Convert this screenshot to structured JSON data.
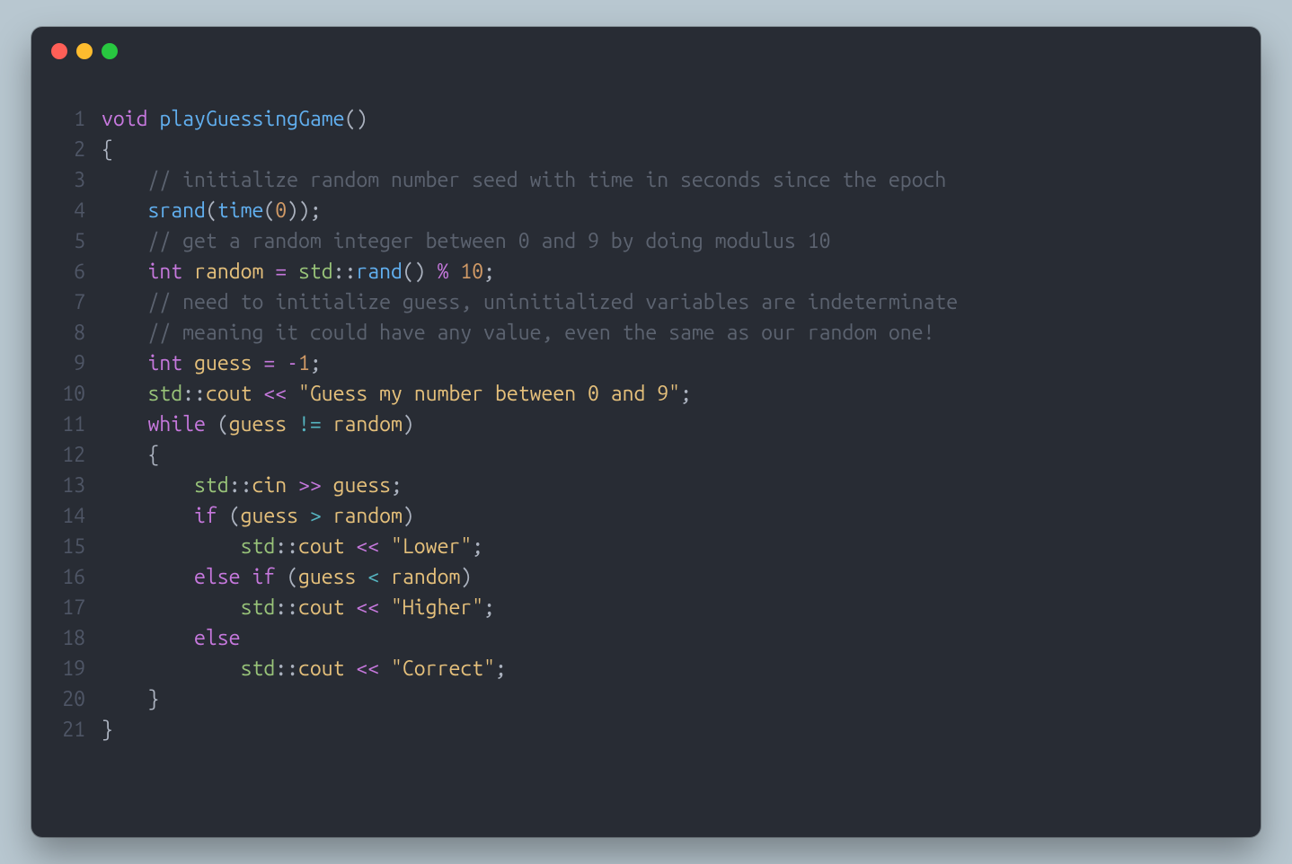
{
  "traffic_lights": [
    "close",
    "minimize",
    "zoom"
  ],
  "code": {
    "lines": [
      {
        "n": 1,
        "tokens": [
          [
            "kw",
            "void"
          ],
          [
            "punc",
            " "
          ],
          [
            "fn",
            "playGuessingGame"
          ],
          [
            "punc",
            "()"
          ]
        ]
      },
      {
        "n": 2,
        "tokens": [
          [
            "punc",
            "{"
          ]
        ]
      },
      {
        "n": 3,
        "tokens": [
          [
            "punc",
            "    "
          ],
          [
            "cmt",
            "// initialize random number seed with time in seconds since the epoch"
          ]
        ]
      },
      {
        "n": 4,
        "tokens": [
          [
            "punc",
            "    "
          ],
          [
            "fn",
            "srand"
          ],
          [
            "punc",
            "("
          ],
          [
            "fn",
            "time"
          ],
          [
            "punc",
            "("
          ],
          [
            "num",
            "0"
          ],
          [
            "punc",
            "));"
          ]
        ]
      },
      {
        "n": 5,
        "tokens": [
          [
            "punc",
            "    "
          ],
          [
            "cmt",
            "// get a random integer between 0 and 9 by doing modulus 10"
          ]
        ]
      },
      {
        "n": 6,
        "tokens": [
          [
            "punc",
            "    "
          ],
          [
            "type",
            "int"
          ],
          [
            "punc",
            " "
          ],
          [
            "var",
            "random"
          ],
          [
            "punc",
            " "
          ],
          [
            "opp",
            "="
          ],
          [
            "punc",
            " "
          ],
          [
            "ns",
            "std"
          ],
          [
            "punc",
            "::"
          ],
          [
            "fn",
            "rand"
          ],
          [
            "punc",
            "() "
          ],
          [
            "opp",
            "%"
          ],
          [
            "punc",
            " "
          ],
          [
            "num",
            "10"
          ],
          [
            "punc",
            ";"
          ]
        ]
      },
      {
        "n": 7,
        "tokens": [
          [
            "punc",
            "    "
          ],
          [
            "cmt",
            "// need to initialize guess, uninitialized variables are indeterminate"
          ]
        ]
      },
      {
        "n": 8,
        "tokens": [
          [
            "punc",
            "    "
          ],
          [
            "cmt",
            "// meaning it could have any value, even the same as our random one!"
          ]
        ]
      },
      {
        "n": 9,
        "tokens": [
          [
            "punc",
            "    "
          ],
          [
            "type",
            "int"
          ],
          [
            "punc",
            " "
          ],
          [
            "var",
            "guess"
          ],
          [
            "punc",
            " "
          ],
          [
            "opp",
            "="
          ],
          [
            "punc",
            " "
          ],
          [
            "opp",
            "-"
          ],
          [
            "num",
            "1"
          ],
          [
            "punc",
            ";"
          ]
        ]
      },
      {
        "n": 10,
        "tokens": [
          [
            "punc",
            "    "
          ],
          [
            "ns",
            "std"
          ],
          [
            "punc",
            "::"
          ],
          [
            "var",
            "cout"
          ],
          [
            "punc",
            " "
          ],
          [
            "opp",
            "<<"
          ],
          [
            "punc",
            " "
          ],
          [
            "str",
            "\"Guess my number between 0 and 9\""
          ],
          [
            "punc",
            ";"
          ]
        ]
      },
      {
        "n": 11,
        "tokens": [
          [
            "punc",
            "    "
          ],
          [
            "kw",
            "while"
          ],
          [
            "punc",
            " ("
          ],
          [
            "var",
            "guess"
          ],
          [
            "punc",
            " "
          ],
          [
            "op",
            "!="
          ],
          [
            "punc",
            " "
          ],
          [
            "var",
            "random"
          ],
          [
            "punc",
            ")"
          ]
        ]
      },
      {
        "n": 12,
        "tokens": [
          [
            "punc",
            "    {"
          ]
        ]
      },
      {
        "n": 13,
        "tokens": [
          [
            "punc",
            "        "
          ],
          [
            "ns",
            "std"
          ],
          [
            "punc",
            "::"
          ],
          [
            "var",
            "cin"
          ],
          [
            "punc",
            " "
          ],
          [
            "opp",
            ">>"
          ],
          [
            "punc",
            " "
          ],
          [
            "var",
            "guess"
          ],
          [
            "punc",
            ";"
          ]
        ]
      },
      {
        "n": 14,
        "tokens": [
          [
            "punc",
            "        "
          ],
          [
            "kw",
            "if"
          ],
          [
            "punc",
            " ("
          ],
          [
            "var",
            "guess"
          ],
          [
            "punc",
            " "
          ],
          [
            "op",
            ">"
          ],
          [
            "punc",
            " "
          ],
          [
            "var",
            "random"
          ],
          [
            "punc",
            ")"
          ]
        ]
      },
      {
        "n": 15,
        "tokens": [
          [
            "punc",
            "            "
          ],
          [
            "ns",
            "std"
          ],
          [
            "punc",
            "::"
          ],
          [
            "var",
            "cout"
          ],
          [
            "punc",
            " "
          ],
          [
            "opp",
            "<<"
          ],
          [
            "punc",
            " "
          ],
          [
            "str",
            "\"Lower\""
          ],
          [
            "punc",
            ";"
          ]
        ]
      },
      {
        "n": 16,
        "tokens": [
          [
            "punc",
            "        "
          ],
          [
            "kw",
            "else"
          ],
          [
            "punc",
            " "
          ],
          [
            "kw",
            "if"
          ],
          [
            "punc",
            " ("
          ],
          [
            "var",
            "guess"
          ],
          [
            "punc",
            " "
          ],
          [
            "op",
            "<"
          ],
          [
            "punc",
            " "
          ],
          [
            "var",
            "random"
          ],
          [
            "punc",
            ")"
          ]
        ]
      },
      {
        "n": 17,
        "tokens": [
          [
            "punc",
            "            "
          ],
          [
            "ns",
            "std"
          ],
          [
            "punc",
            "::"
          ],
          [
            "var",
            "cout"
          ],
          [
            "punc",
            " "
          ],
          [
            "opp",
            "<<"
          ],
          [
            "punc",
            " "
          ],
          [
            "str",
            "\"Higher\""
          ],
          [
            "punc",
            ";"
          ]
        ]
      },
      {
        "n": 18,
        "tokens": [
          [
            "punc",
            "        "
          ],
          [
            "kw",
            "else"
          ]
        ]
      },
      {
        "n": 19,
        "tokens": [
          [
            "punc",
            "            "
          ],
          [
            "ns",
            "std"
          ],
          [
            "punc",
            "::"
          ],
          [
            "var",
            "cout"
          ],
          [
            "punc",
            " "
          ],
          [
            "opp",
            "<<"
          ],
          [
            "punc",
            " "
          ],
          [
            "str",
            "\"Correct\""
          ],
          [
            "punc",
            ";"
          ]
        ]
      },
      {
        "n": 20,
        "tokens": [
          [
            "punc",
            "    }"
          ]
        ]
      },
      {
        "n": 21,
        "tokens": [
          [
            "punc",
            "}"
          ]
        ]
      }
    ]
  }
}
